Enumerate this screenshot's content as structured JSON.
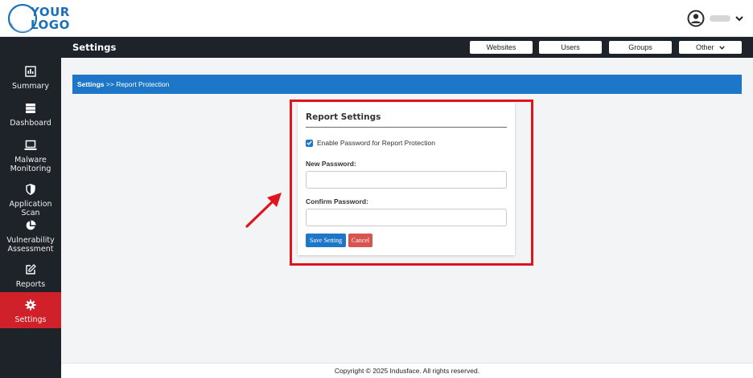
{
  "logo": {
    "line1": "YOUR",
    "line2": "LOGO",
    "color": "#1d6fb8"
  },
  "user": {
    "avatar_icon": "user-circle-icon",
    "chevron_icon": "chevron-down-icon"
  },
  "sidebar": {
    "items": [
      {
        "label": "Summary",
        "icon": "summary-chart-icon"
      },
      {
        "label": "Dashboard",
        "icon": "server-stack-icon"
      },
      {
        "label": "Malware\nMonitoring",
        "icon": "laptop-icon"
      },
      {
        "label": "Application Scan",
        "icon": "shield-icon"
      },
      {
        "label": "Vulnerability\nAssessment",
        "icon": "pie-chart-icon"
      },
      {
        "label": "Reports",
        "icon": "edit-icon"
      },
      {
        "label": "Settings",
        "icon": "gear-icon",
        "active": true
      }
    ]
  },
  "header": {
    "title": "Settings",
    "buttons": {
      "websites": "Websites",
      "users": "Users",
      "groups": "Groups",
      "other": "Other"
    }
  },
  "breadcrumb": {
    "root": "Settings",
    "separator": " >> ",
    "current": "Report Protection"
  },
  "card": {
    "title": "Report Settings",
    "checkbox_label": "Enable Password for Report Protection",
    "checkbox_checked": true,
    "new_password_label": "New Password:",
    "new_password_value": "",
    "confirm_password_label": "Confirm Password:",
    "confirm_password_value": "",
    "save_label": "Save Setting",
    "cancel_label": "Cancel"
  },
  "footer": {
    "text": "Copyright © 2025 Indusface. All rights reserved."
  },
  "colors": {
    "sidebar_bg": "#1e2329",
    "active_nav": "#d0202a",
    "breadcrumb_bg": "#1e76c8",
    "save_button": "#1e76c8",
    "cancel_button": "#d9534f",
    "annotation": "#e0141c"
  }
}
